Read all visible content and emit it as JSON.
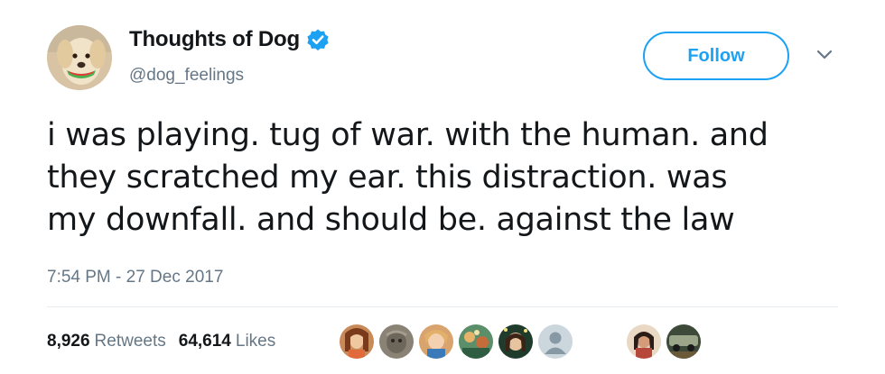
{
  "author": {
    "display_name": "Thoughts of Dog",
    "handle": "@dog_feelings",
    "verified": true
  },
  "follow_label": "Follow",
  "tweet": {
    "lines": [
      "i was playing. tug of war. with the human. and",
      "they scratched my ear. this distraction. was",
      "my downfall. and should be. against the law"
    ],
    "timestamp": "7:54 PM - 27 Dec 2017"
  },
  "stats": {
    "retweets_count": "8,926",
    "retweets_label": "Retweets",
    "likes_count": "64,614",
    "likes_label": "Likes"
  },
  "colors": {
    "accent": "#1da1f2",
    "secondary_text": "#657786",
    "primary_text": "#14171a",
    "divider": "#e6ecf0"
  },
  "icons": {
    "verified": "verified-badge-icon",
    "more": "chevron-down-icon"
  }
}
